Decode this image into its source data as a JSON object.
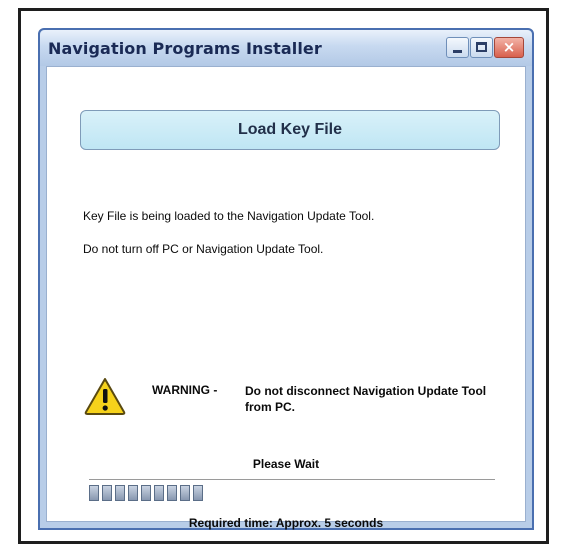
{
  "window": {
    "title": "Navigation Programs Installer",
    "close_glyph": "×"
  },
  "header": {
    "title": "Load Key File"
  },
  "messages": {
    "line1": "Key File is being loaded to the Navigation Update Tool.",
    "line2": "Do not turn off PC or Navigation Update Tool."
  },
  "warning": {
    "icon": "warning-icon",
    "label": "WARNING -",
    "text": "Do not disconnect Navigation Update Tool from PC."
  },
  "progress": {
    "status": "Please Wait",
    "segments_filled": 9,
    "required_time": "Required time: Approx. 5 seconds"
  },
  "colors": {
    "header_fill": "#cdebf7",
    "window_frame": "#b8cde8",
    "close_button": "#d8604d",
    "warning_yellow": "#f6d21b"
  }
}
